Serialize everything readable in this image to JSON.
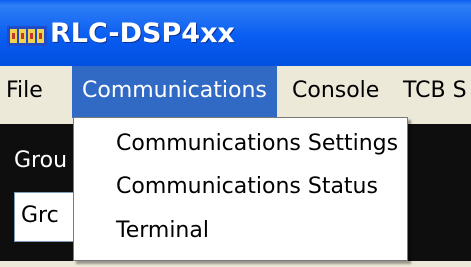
{
  "window": {
    "title": "RLC-DSP4xx",
    "icon": "app-icon"
  },
  "menubar": {
    "items": [
      {
        "label": "File"
      },
      {
        "label": "Communications"
      },
      {
        "label": "Console"
      },
      {
        "label": "TCB S"
      }
    ],
    "selected": "Communications"
  },
  "dropdown": {
    "items": [
      {
        "label": "Communications Settings"
      },
      {
        "label": "Communications Status"
      },
      {
        "label": "Terminal"
      }
    ]
  },
  "panel": {
    "group_label": "Grou",
    "group_value": "Grc"
  },
  "colors": {
    "titlebar": "#0a5df2",
    "menu_highlight": "#316ac5",
    "panel_background": "#0e0e0e"
  }
}
